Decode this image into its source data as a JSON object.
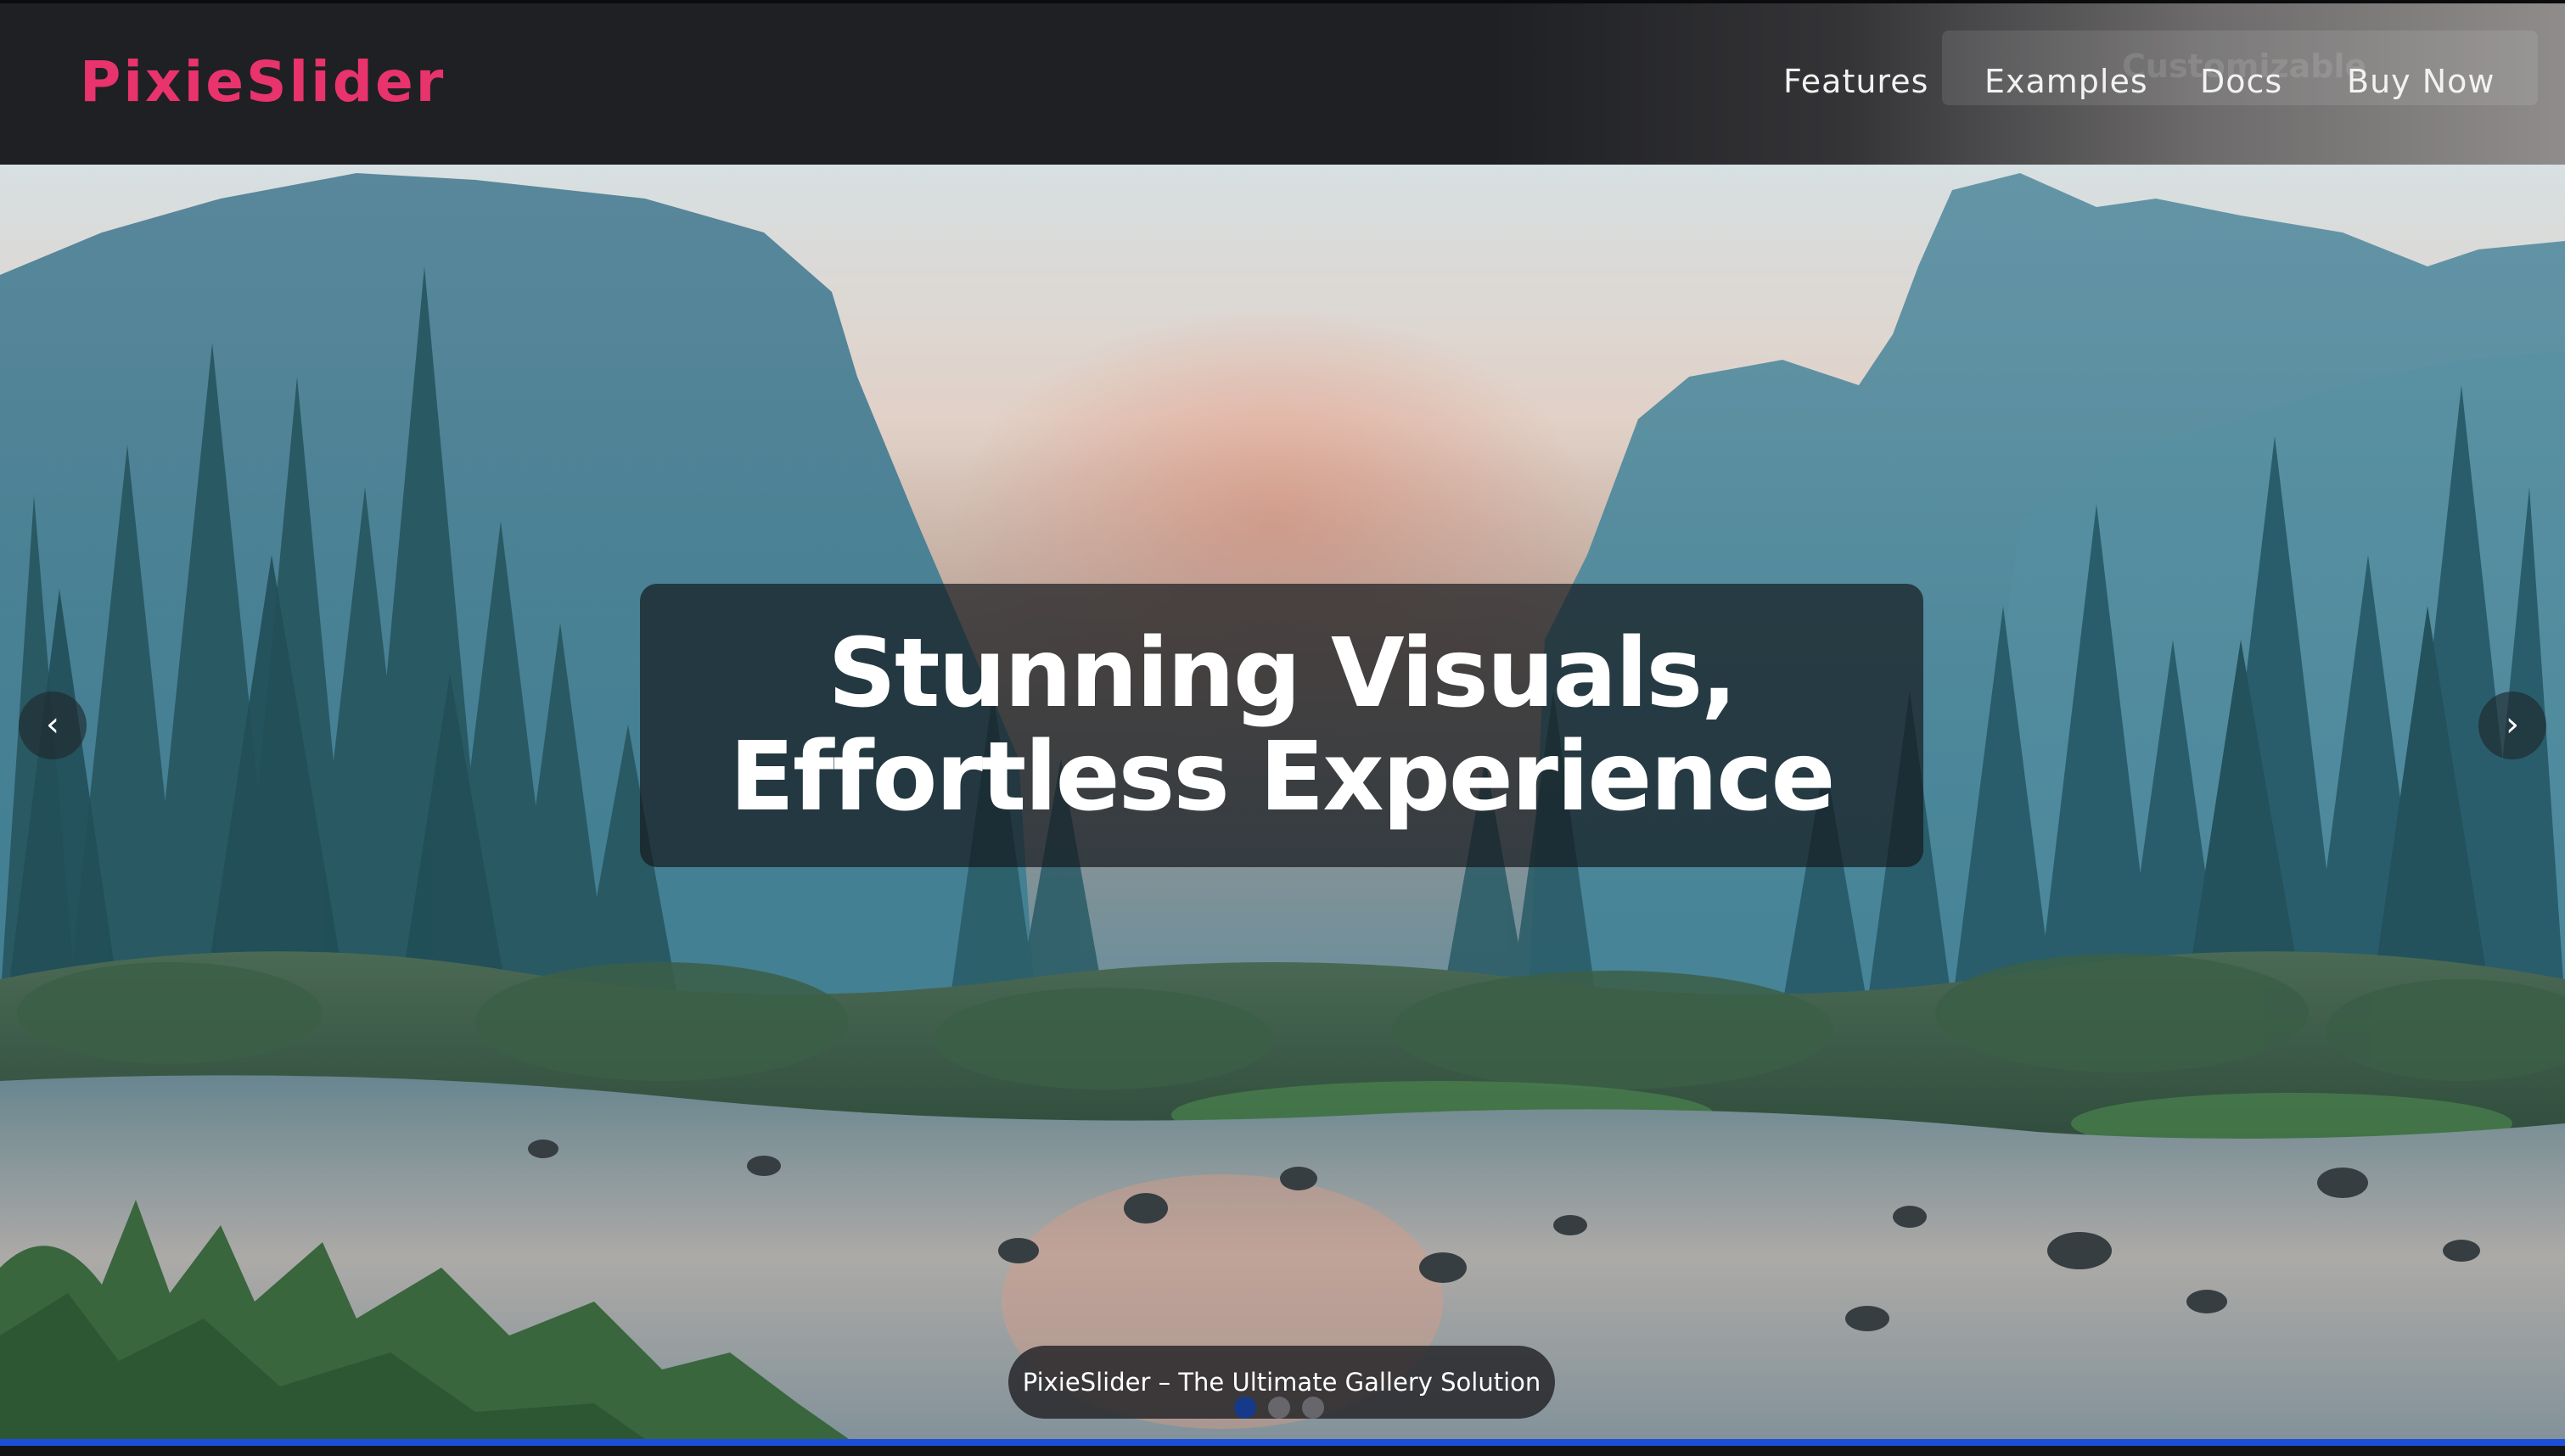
{
  "brand": {
    "logo_text": "PixieSlider",
    "logo_color": "#e8336d"
  },
  "nav": {
    "ghost_text": "Customizable",
    "links": [
      {
        "label": "Features"
      },
      {
        "label": "Examples"
      },
      {
        "label": "Docs"
      },
      {
        "label": "Buy Now"
      }
    ]
  },
  "slider": {
    "headline_line1": "Stunning Visuals,",
    "headline_line2": "Effortless Experience",
    "prev_icon": "‹",
    "next_icon": "›",
    "caption": "PixieSlider – The Ultimate Gallery Solution",
    "slide_count": 3,
    "active_slide": 1,
    "accent_color": "#1d4fd8"
  }
}
